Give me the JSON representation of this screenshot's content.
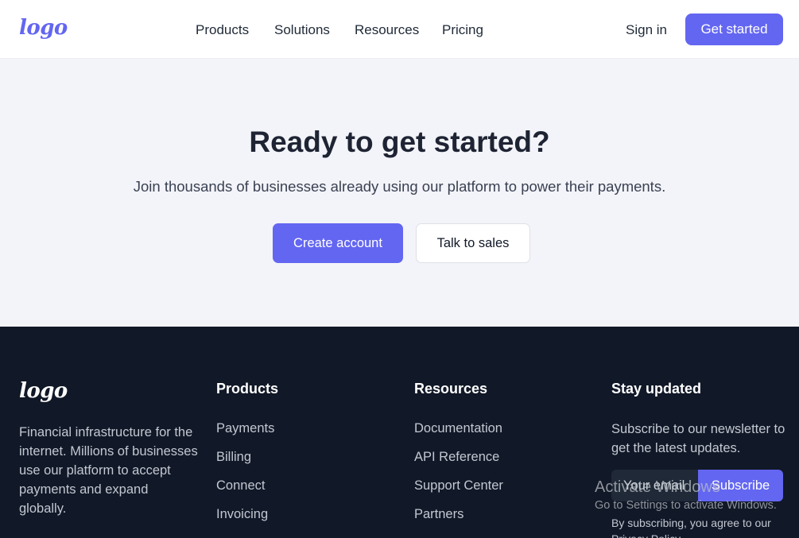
{
  "header": {
    "logo_text": "logo",
    "nav": [
      "Products",
      "Solutions",
      "Resources",
      "Pricing"
    ],
    "sign_in": "Sign in",
    "get_started": "Get started"
  },
  "cta": {
    "title": "Ready to get started?",
    "subtitle": "Join thousands of businesses already using our platform to power their payments.",
    "create_account": "Create account",
    "talk_to_sales": "Talk to sales"
  },
  "footer": {
    "logo_text": "logo",
    "description": "Financial infrastructure for the internet. Millions of businesses use our platform to accept payments and expand globally.",
    "products": {
      "heading": "Products",
      "links": [
        "Payments",
        "Billing",
        "Connect",
        "Invoicing"
      ]
    },
    "resources": {
      "heading": "Resources",
      "links": [
        "Documentation",
        "API Reference",
        "Support Center",
        "Partners"
      ]
    },
    "newsletter": {
      "heading": "Stay updated",
      "text": "Subscribe to our newsletter to get the latest updates.",
      "email_placeholder": "Your email",
      "subscribe": "Subscribe",
      "privacy": "By subscribing, you agree to our Privacy Policy"
    }
  },
  "watermark": {
    "title": "Activate Windows",
    "subtitle": "Go to Settings to activate Windows."
  },
  "colors": {
    "accent": "#6366f1",
    "footer_bg": "#111827",
    "cta_bg": "#f3f4f9"
  }
}
